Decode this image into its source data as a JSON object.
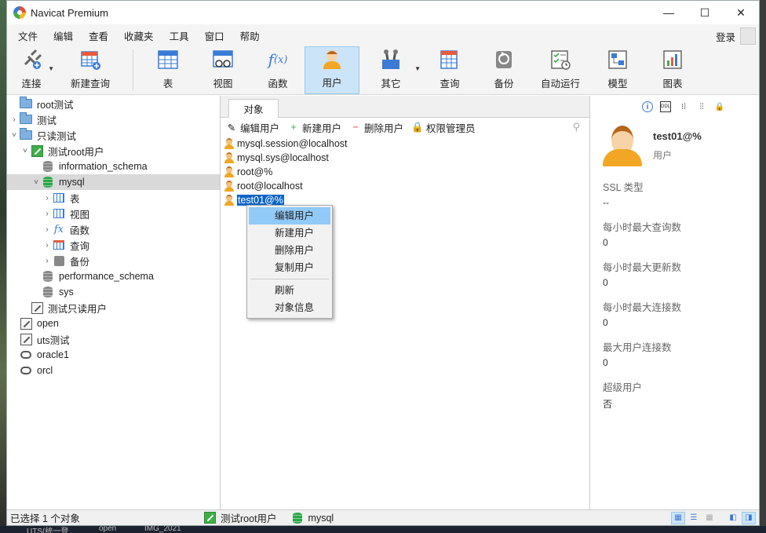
{
  "window": {
    "title": "Navicat Premium"
  },
  "window_controls": {
    "minimize": "—",
    "maximize": "☐",
    "close": "✕"
  },
  "menu": [
    "文件",
    "编辑",
    "查看",
    "收藏夹",
    "工具",
    "窗口",
    "帮助"
  ],
  "login": "登录",
  "toolbar": [
    {
      "label": "连接",
      "icon": "plug-icon"
    },
    {
      "label": "新建查询",
      "icon": "new-query-icon"
    },
    {
      "label": "表",
      "icon": "table-icon"
    },
    {
      "label": "视图",
      "icon": "view-icon"
    },
    {
      "label": "函数",
      "icon": "function-icon"
    },
    {
      "label": "用户",
      "icon": "user-icon"
    },
    {
      "label": "其它",
      "icon": "tools-icon"
    },
    {
      "label": "查询",
      "icon": "query-icon"
    },
    {
      "label": "备份",
      "icon": "backup-icon"
    },
    {
      "label": "自动运行",
      "icon": "schedule-icon"
    },
    {
      "label": "模型",
      "icon": "model-icon"
    },
    {
      "label": "图表",
      "icon": "chart-icon"
    }
  ],
  "tree": [
    "root测试",
    "测试",
    "只读测试",
    "测试root用户",
    "information_schema",
    "mysql",
    "表",
    "视图",
    "函数",
    "查询",
    "备份",
    "performance_schema",
    "sys",
    "测试只读用户",
    "open",
    "uts测试",
    "oracle1",
    "orcl"
  ],
  "tabs": {
    "objects": "对象"
  },
  "actions": {
    "edit": "编辑用户",
    "new": "新建用户",
    "delete": "删除用户",
    "privilege": "权限管理员"
  },
  "users": [
    "mysql.session@localhost",
    "mysql.sys@localhost",
    "root@%",
    "root@localhost",
    "test01@%"
  ],
  "context_menu": [
    "编辑用户",
    "新建用户",
    "删除用户",
    "复制用户",
    "刷新",
    "对象信息"
  ],
  "info": {
    "name": "test01@%",
    "type": "用户",
    "props": [
      {
        "label": "SSL 类型",
        "value": "--"
      },
      {
        "label": "每小时最大查询数",
        "value": "0"
      },
      {
        "label": "每小时最大更新数",
        "value": "0"
      },
      {
        "label": "每小时最大连接数",
        "value": "0"
      },
      {
        "label": "最大用户连接数",
        "value": "0"
      },
      {
        "label": "超级用户",
        "value": "否"
      }
    ]
  },
  "status": {
    "selected": "已选择 1 个对象",
    "connection": "测试root用户",
    "database": "mysql"
  },
  "taskbar": [
    "UTS(统一登",
    "open",
    "IMG_2021"
  ]
}
